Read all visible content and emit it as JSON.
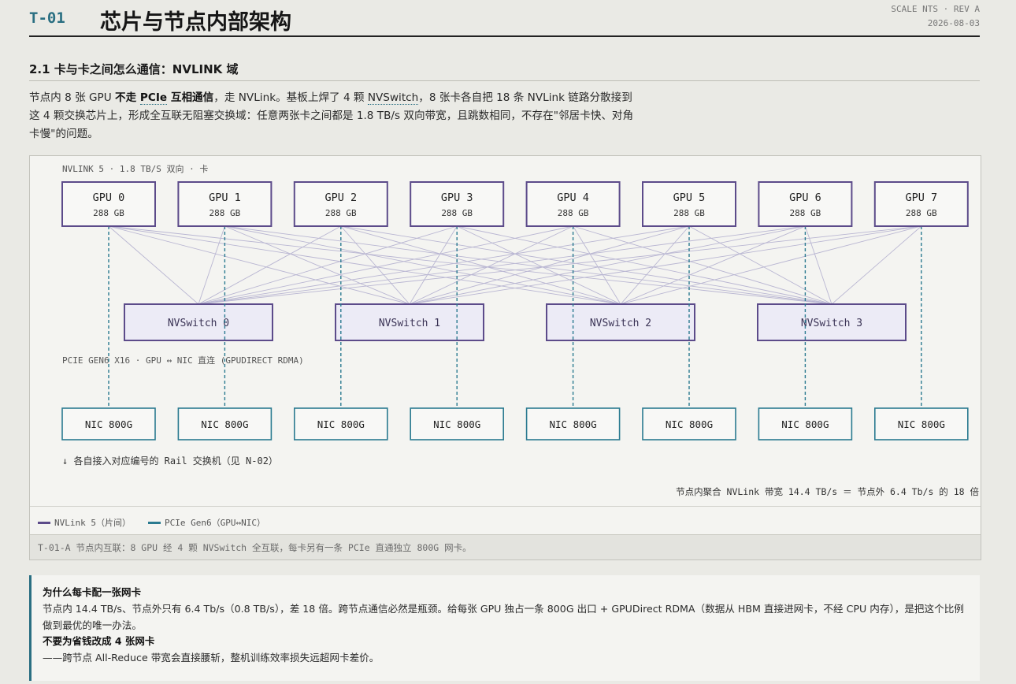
{
  "header": {
    "doc_id": "T-01",
    "title": "芯片与节点内部架构",
    "meta_line1": "SCALE NTS · REV A",
    "meta_line2": "2026-08-03"
  },
  "section": {
    "heading": "2.1 卡与卡之间怎么通信：NVLINK 域"
  },
  "intro": {
    "p1": "节点内 8 张 GPU ",
    "b1": "不走 ",
    "term1": "PCIe",
    "b2": " 互相通信",
    "p2": "，走 NVLink。基板上焊了 4 颗 ",
    "term2": "NVSwitch",
    "p3": "，8 张卡各自把 18 条 NVLink 链路分散接到这 4 颗交换芯片上，形成全互联无阻塞交换域：任意两张卡之间都是 1.8 TB/s 双向带宽，且跳数相同，不存在\"邻居卡快、对角卡慢\"的问题。"
  },
  "diagram": {
    "nvlink_label": "NVLINK 5 · 1.8 TB/S 双向 · 卡",
    "pcie_label": "PCIE GEN6 X16 · GPU ↔ NIC 直连 (GPUDIRECT RDMA)",
    "rail_note": "↓ 各自接入对应编号的 Rail 交换机（见 N-02）",
    "aggregate_note": "节点内聚合 NVLink 带宽 14.4 TB/s ＝ 节点外 6.4 Tb/s 的 18 倍",
    "gpus": [
      {
        "name": "GPU 0",
        "mem": "288 GB"
      },
      {
        "name": "GPU 1",
        "mem": "288 GB"
      },
      {
        "name": "GPU 2",
        "mem": "288 GB"
      },
      {
        "name": "GPU 3",
        "mem": "288 GB"
      },
      {
        "name": "GPU 4",
        "mem": "288 GB"
      },
      {
        "name": "GPU 5",
        "mem": "288 GB"
      },
      {
        "name": "GPU 6",
        "mem": "288 GB"
      },
      {
        "name": "GPU 7",
        "mem": "288 GB"
      }
    ],
    "switches": [
      "NVSwitch 0",
      "NVSwitch 1",
      "NVSwitch 2",
      "NVSwitch 3"
    ],
    "nics": [
      "NIC 800G",
      "NIC 800G",
      "NIC 800G",
      "NIC 800G",
      "NIC 800G",
      "NIC 800G",
      "NIC 800G",
      "NIC 800G"
    ],
    "colors": {
      "gpu_border": "#5c4b8a",
      "switch_fill": "#ecebf6",
      "nic_border": "#2a7a90",
      "nvlink_line": "#b9b6d2",
      "pcie_line": "#2a7a90"
    }
  },
  "legend": {
    "nvlink": "NVLink 5（片间）",
    "pcie": "PCIe Gen6（GPU↔NIC）"
  },
  "caption": "T-01-A 节点内互联：8 GPU 经 4 颗 NVSwitch 全互联，每卡另有一条 PCIe 直通独立 800G 网卡。",
  "note": {
    "h1": "为什么每卡配一张网卡",
    "t1": "节点内 14.4 TB/s、节点外只有 6.4 Tb/s（0.8 TB/s），差 18 倍。跨节点通信必然是瓶颈。给每张 GPU 独占一条 800G 出口 + GPUDirect RDMA（数据从 HBM 直接进网卡，不经 CPU 内存），是把这个比例做到最优的唯一办法。",
    "h2": "不要为省钱改成 4 张网卡",
    "t2": "——跨节点 All-Reduce 带宽会直接腰斩，整机训练效率损失远超网卡差价。"
  }
}
